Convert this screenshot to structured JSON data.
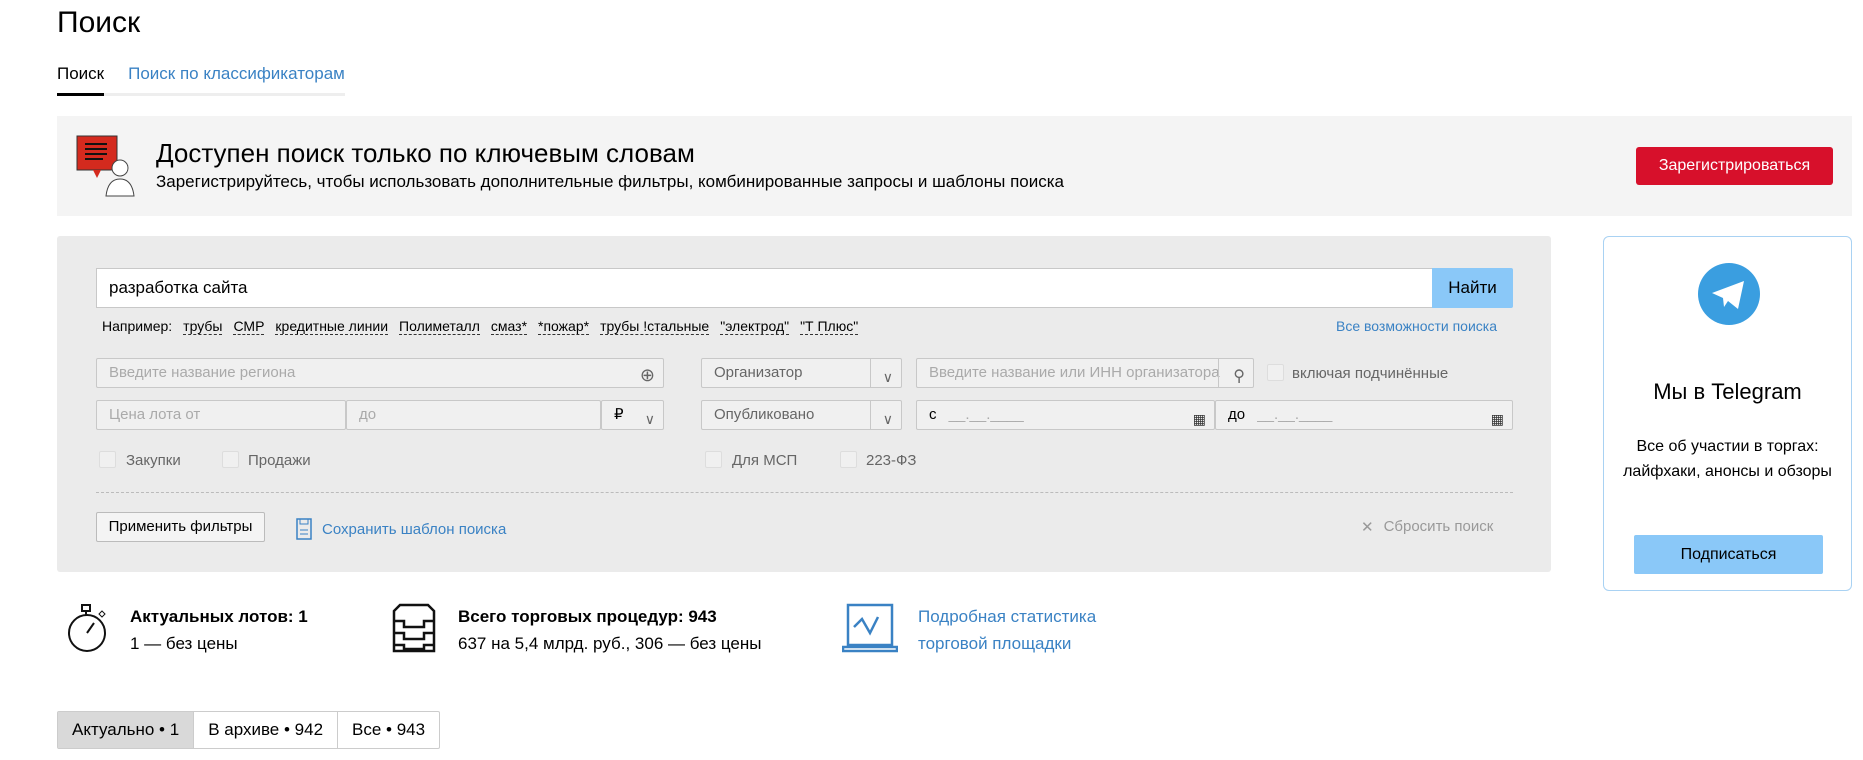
{
  "page": {
    "title": "Поиск"
  },
  "tabs": [
    {
      "label": "Поиск",
      "active": true
    },
    {
      "label": "Поиск по классификаторам",
      "active": false
    }
  ],
  "banner": {
    "heading": "Доступен поиск только по ключевым словам",
    "subtext": "Зарегистрируйтесь, чтобы использовать дополнительные фильтры, комбинированные запросы и шаблоны поиска",
    "register_label": "Зарегистрироваться"
  },
  "search": {
    "value": "разработка сайта",
    "find_label": "Найти",
    "examples_label": "Например:",
    "examples": [
      "трубы",
      "СМР",
      "кредитные линии",
      "Полиметалл",
      "смаз*",
      "*пожар*",
      "трубы !стальные",
      "\"электрод\"",
      "\"Т Плюс\""
    ],
    "all_options": "Все возможности поиска"
  },
  "filters": {
    "region_placeholder": "Введите название региона",
    "organizer_select": "Организатор",
    "organizer_placeholder": "Введите название или ИНН организатора",
    "include_sub": "включая подчинённые",
    "price_from": "Цена лота от",
    "price_to": "до",
    "currency": "₽",
    "published_select": "Опубликовано",
    "date_from_label": "с",
    "date_to_label": "до",
    "date_mask": "__.__.____",
    "purchases": "Закупки",
    "sales": "Продажи",
    "msp": "Для МСП",
    "fz223": "223-ФЗ",
    "apply": "Применить фильтры",
    "save_template": "Сохранить шаблон поиска",
    "reset": "Сбросить поиск"
  },
  "telegram": {
    "title": "Мы в Telegram",
    "text": "Все об участии в торгах: лайфхаки, анонсы и обзоры",
    "subscribe": "Подписаться"
  },
  "stats": {
    "lots_title": "Актуальных лотов: 1",
    "lots_sub": "1 — без цены",
    "proc_title": "Всего торговых процедур: 943",
    "proc_sub": "637 на 5,4 млрд. руб., 306 — без цены",
    "link1": "Подробная статистика",
    "link2": "торговой площадки"
  },
  "result_tabs": [
    {
      "label": "Актуально • 1",
      "active": true
    },
    {
      "label": "В архиве • 942"
    },
    {
      "label": "Все • 943"
    }
  ],
  "colors": {
    "accent": "#3a82c4",
    "register": "#d7102b",
    "find": "#8ac8f8"
  }
}
